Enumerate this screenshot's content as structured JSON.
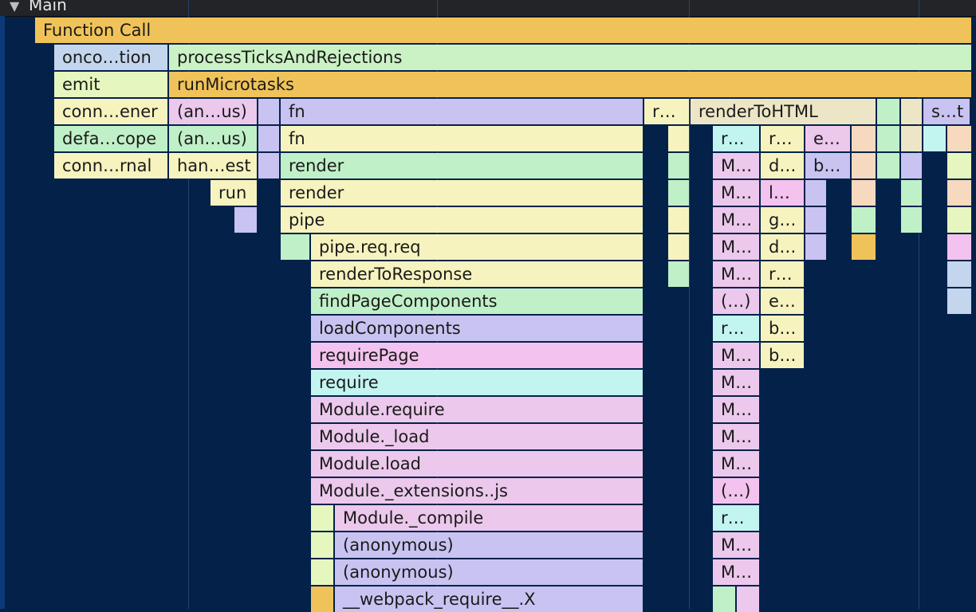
{
  "track": {
    "toggle_icon": "triangle-down-icon",
    "title": "Main"
  },
  "colors": {
    "background": "#04214a",
    "yellow": "#f0c35a",
    "green": "#caf2c4",
    "lime": "#e6f6bf",
    "lavender": "#c9c3f2",
    "pink": "#ecc8ec",
    "cream": "#f6f3bf",
    "mint": "#c0f0c8",
    "cyan": "#c2f4f0",
    "peach": "#f6d9bf",
    "tan": "#ede6c6",
    "blue": "#c3d6ee",
    "magenta": "#f3c2ee"
  },
  "flame": {
    "function_call": "Function Call",
    "row1": [
      "onco…tion",
      "processTicksAndRejections"
    ],
    "row2": [
      "emit",
      "runMicrotasks"
    ],
    "row3": [
      "conn…ener",
      "(an…us)",
      "fn",
      "r…",
      "renderToHTML",
      "s…t"
    ],
    "row4": [
      "defa…cope",
      "(an…us)",
      "fn",
      "r…",
      "r…",
      "e…"
    ],
    "row5": [
      "conn…rnal",
      "han…est",
      "render",
      "M…",
      "d…",
      "b…"
    ],
    "row6": [
      "run",
      "render",
      "M…",
      "l…"
    ],
    "row7": [
      "pipe",
      "M…",
      "g…"
    ],
    "row8": [
      "pipe.req.req",
      "M…",
      "d…"
    ],
    "row9": [
      "renderToResponse",
      "M…",
      "r…"
    ],
    "row10": [
      "findPageComponents",
      "(…)",
      "e…"
    ],
    "row11": [
      "loadComponents",
      "r…",
      "b…"
    ],
    "row12": [
      "requirePage",
      "M…",
      "b…"
    ],
    "row13": [
      "require",
      "M…"
    ],
    "row14": [
      "Module.require",
      "M…"
    ],
    "row15": [
      "Module._load",
      "M…"
    ],
    "row16": [
      "Module.load",
      "M…"
    ],
    "row17": [
      "Module._extensions..js",
      "(…)"
    ],
    "row18": [
      "Module._compile",
      "r…"
    ],
    "row19": [
      "(anonymous)",
      "M…"
    ],
    "row20": [
      "(anonymous)",
      "M…"
    ],
    "row21": [
      "__webpack_require__.X"
    ]
  }
}
